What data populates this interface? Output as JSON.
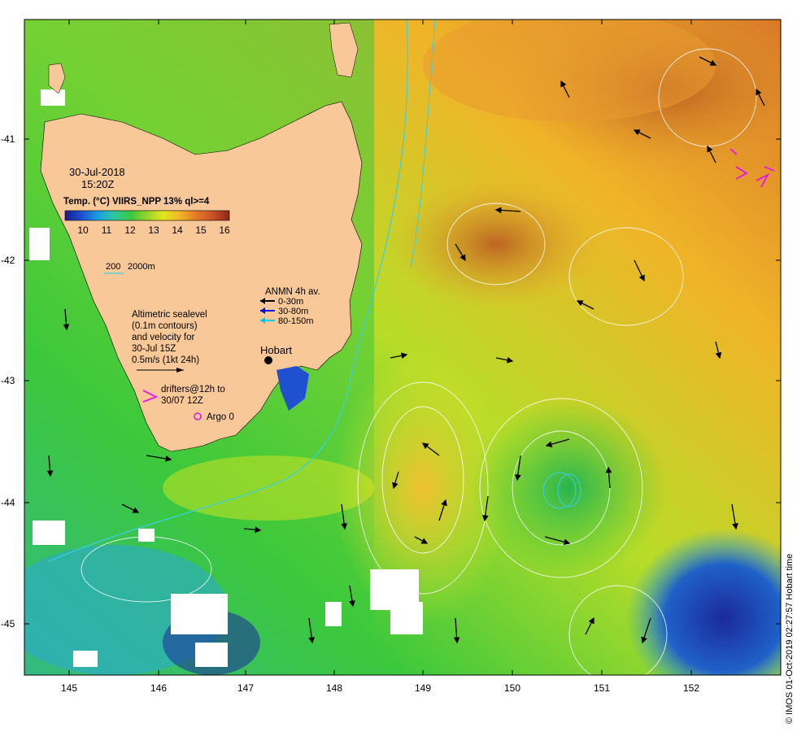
{
  "map": {
    "date": "30-Jul-2018",
    "time": "15:20Z",
    "sst_title": "Temp. (°C) VIIRS_NPP 13% ql>=4",
    "colorbar_ticks": [
      "10",
      "11",
      "12",
      "13",
      "14",
      "15",
      "16"
    ],
    "colorbar_colors": [
      "#1a1a8c",
      "#1e50d0",
      "#1aa0e0",
      "#2ec8a0",
      "#3cc83c",
      "#9ad22a",
      "#e6e61e",
      "#f0b428",
      "#e67828",
      "#c85028",
      "#8c2814"
    ],
    "isobath_label_200": "200",
    "isobath_label_2000": "2000m",
    "anmn_title": "ANMN 4h av.",
    "anmn_depths": [
      "0-30m",
      "30-80m",
      "80-150m"
    ],
    "anmn_colors": [
      "#000000",
      "#0000e0",
      "#00c8e6"
    ],
    "altimetry_lines": [
      "Altimetric sealevel",
      "(0.1m contours)",
      "and velocity for",
      "30-Jul 15Z",
      "0.5m/s (1kt 24h)"
    ],
    "drifters_lines": [
      "drifters@12h to",
      "30/07 12Z"
    ],
    "drifter_color": "#e020e0",
    "argo_label": "Argo 0",
    "city": "Hobart",
    "credit": "© IMOS 01-Oct-2019 02:27:57 Hobart time",
    "lat_labels": [
      "-41",
      "-42",
      "-43",
      "-44",
      "-45"
    ],
    "lon_labels": [
      "145",
      "146",
      "147",
      "148",
      "149",
      "150",
      "151",
      "152"
    ],
    "land_color": "#f8c898"
  }
}
